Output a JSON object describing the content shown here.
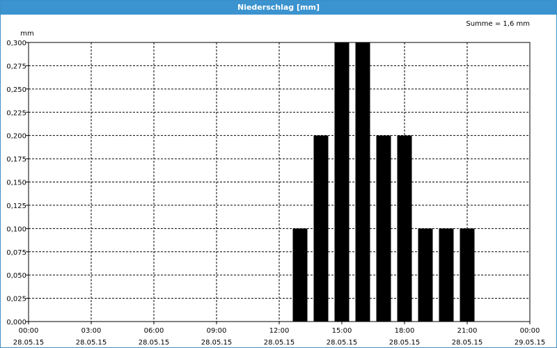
{
  "window": {
    "title": "Niederschlag [mm]"
  },
  "chart_data": {
    "type": "bar",
    "title": "Niederschlag [mm]",
    "unit_label": "mm",
    "summary": "Summe = 1,6 mm",
    "ylim": [
      0,
      0.3
    ],
    "yticks": [
      "0,000",
      "0,025",
      "0,050",
      "0,075",
      "0,100",
      "0,125",
      "0,150",
      "0,175",
      "0,200",
      "0,225",
      "0,250",
      "0,275",
      "0,300"
    ],
    "xlim_hours": [
      0,
      24
    ],
    "xticks": [
      {
        "time": "00:00",
        "date": "28.05.15"
      },
      {
        "time": "03:00",
        "date": "28.05.15"
      },
      {
        "time": "06:00",
        "date": "28.05.15"
      },
      {
        "time": "09:00",
        "date": "28.05.15"
      },
      {
        "time": "12:00",
        "date": "28.05.15"
      },
      {
        "time": "15:00",
        "date": "28.05.15"
      },
      {
        "time": "18:00",
        "date": "28.05.15"
      },
      {
        "time": "21:00",
        "date": "28.05.15"
      },
      {
        "time": "00:00",
        "date": "29.05.15"
      }
    ],
    "grid": true,
    "bar_color": "#000000",
    "bars": [
      {
        "hour": 13,
        "value": 0.1
      },
      {
        "hour": 14,
        "value": 0.2
      },
      {
        "hour": 15,
        "value": 0.3
      },
      {
        "hour": 16,
        "value": 0.3
      },
      {
        "hour": 17,
        "value": 0.2
      },
      {
        "hour": 18,
        "value": 0.2
      },
      {
        "hour": 19,
        "value": 0.1
      },
      {
        "hour": 20,
        "value": 0.1
      },
      {
        "hour": 21,
        "value": 0.1
      }
    ]
  }
}
